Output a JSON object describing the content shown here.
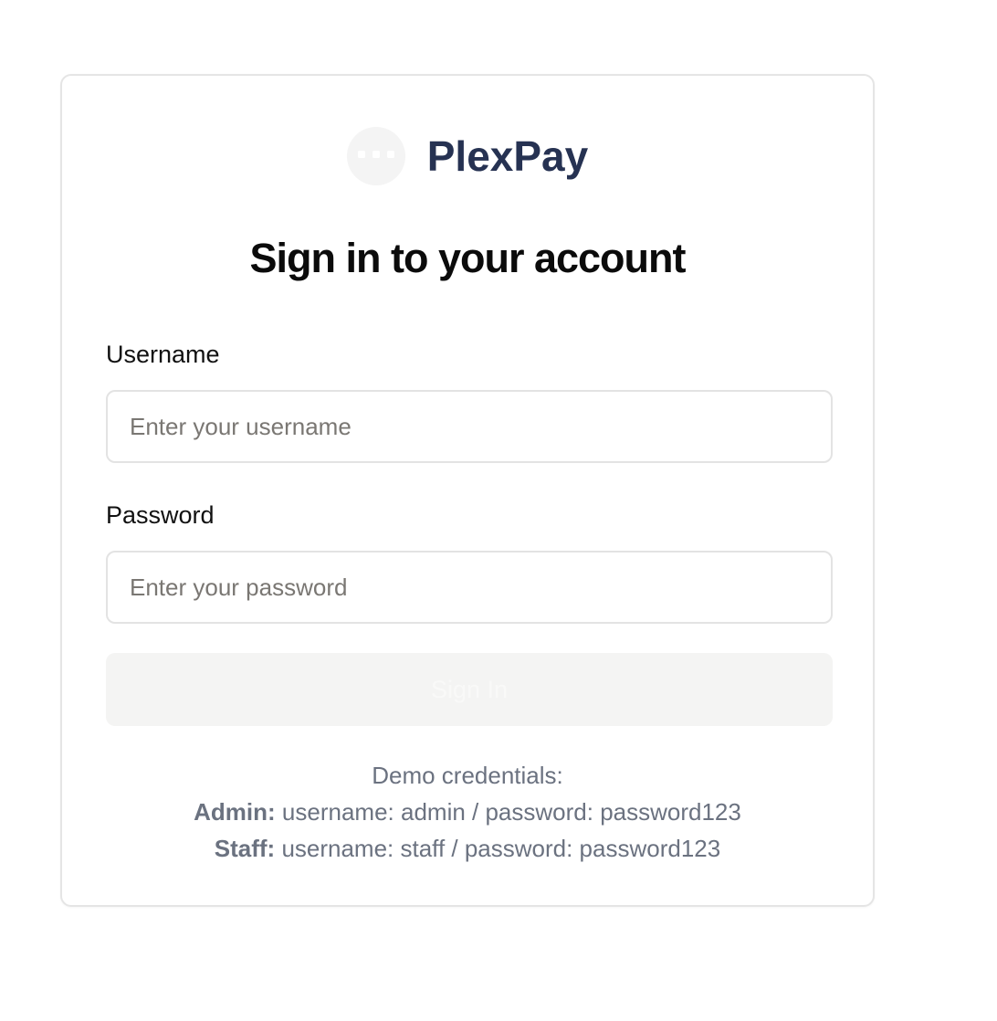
{
  "brand": {
    "name": "PlexPay",
    "logo_icon": "ellipsis-icon"
  },
  "heading": "Sign in to your account",
  "form": {
    "username_label": "Username",
    "username_placeholder": "Enter your username",
    "username_value": "",
    "password_label": "Password",
    "password_placeholder": "Enter your password",
    "password_value": "",
    "submit_label": "Sign In"
  },
  "demo": {
    "title": "Demo credentials:",
    "accounts": [
      {
        "role": "Admin:",
        "details": "username: admin / password: password123"
      },
      {
        "role": "Staff:",
        "details": "username: staff / password: password123"
      }
    ]
  },
  "colors": {
    "brand": "#263252",
    "muted_text": "#6b7280",
    "disabled_button": "#f4f4f3"
  }
}
